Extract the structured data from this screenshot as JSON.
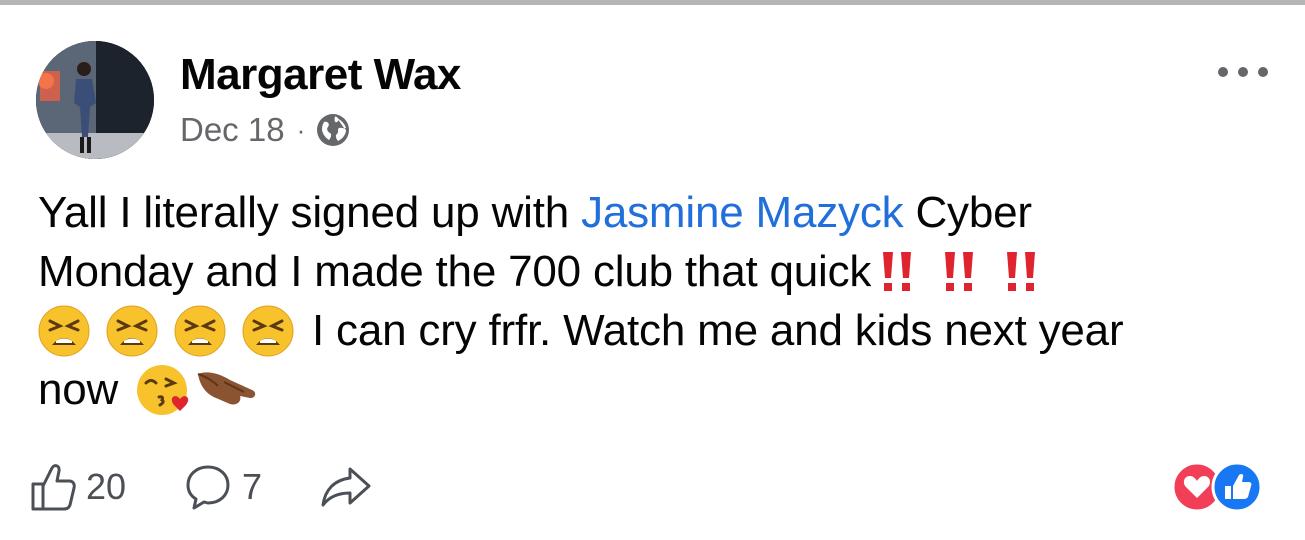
{
  "post": {
    "author": "Margaret Wax",
    "date": "Dec 18",
    "separator": "·",
    "audience_icon": "globe-icon",
    "menu_icon": "more-options-icon",
    "body": {
      "line1_before": "Yall I literally signed up with",
      "mention": "Jasmine Mazyck",
      "line1_after": "Cyber",
      "line2": "Monday and I made the 700 club that quick",
      "line3": "I can cry frfr. Watch me and kids next year",
      "line4": "now",
      "emojis": [
        "double-exclamation-icon",
        "tired-face-icon",
        "face-blowing-kiss-icon",
        "pinching-hand-icon"
      ]
    }
  },
  "actions": {
    "like_count": "20",
    "comment_count": "7",
    "share_icon": "share-icon"
  },
  "reactions": [
    "love-reaction-icon",
    "like-reaction-icon"
  ],
  "colors": {
    "mention": "#216fdb",
    "exclamation": "#e0242f",
    "love": "#f33e58",
    "like": "#1877f2",
    "meta": "#65676b"
  }
}
